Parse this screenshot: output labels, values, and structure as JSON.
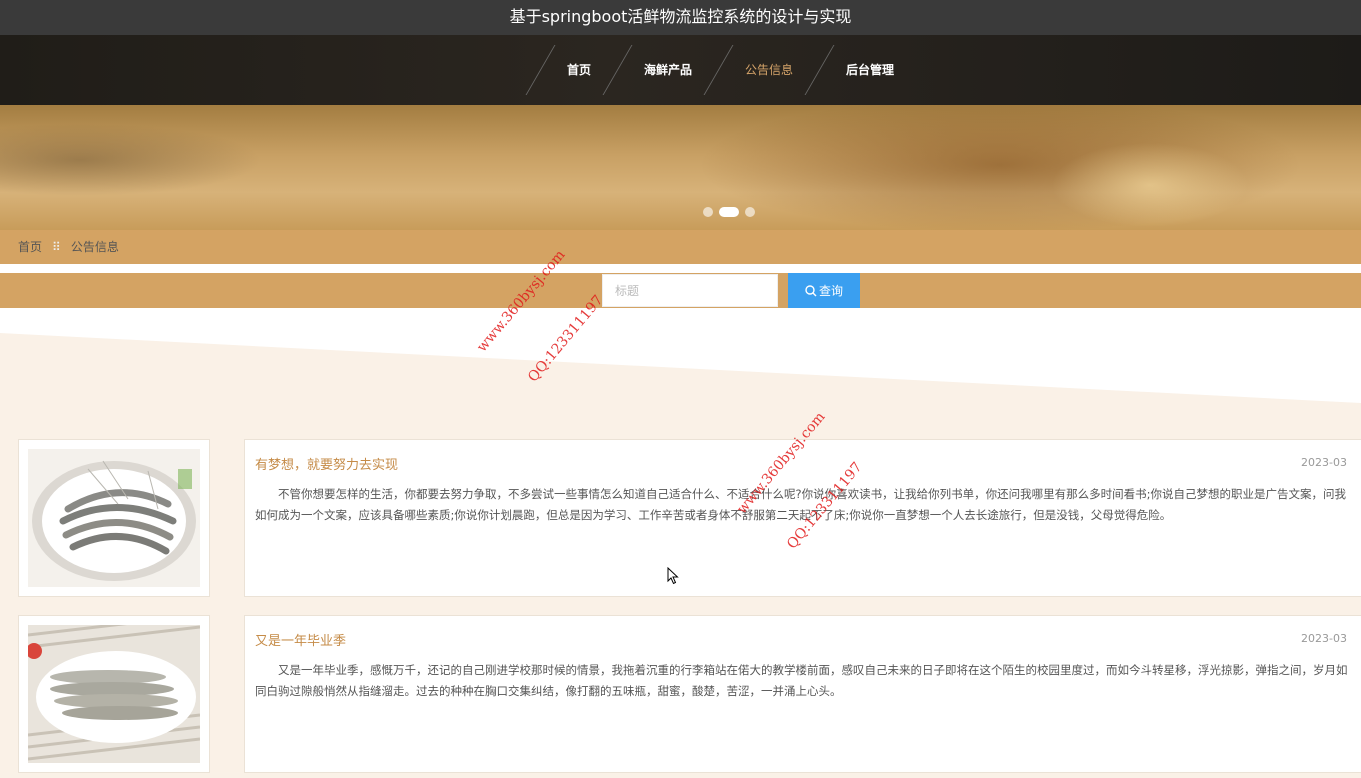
{
  "app": {
    "title": "基于springboot活鲜物流监控系统的设计与实现"
  },
  "nav": {
    "items": [
      "首页",
      "海鲜产品",
      "公告信息",
      "后台管理"
    ],
    "active": "公告信息"
  },
  "carousel": {
    "slides": 3,
    "active_index": 1
  },
  "breadcrumb": {
    "home": "首页",
    "separator": "⠿",
    "current": "公告信息"
  },
  "search": {
    "placeholder": "标题",
    "value": "",
    "button_label": "查询",
    "button_icon": "search-icon"
  },
  "notices": [
    {
      "title": "有梦想，就要努力去实现",
      "date": "2023-03",
      "body": "不管你想要怎样的生活，你都要去努力争取，不多尝试一些事情怎么知道自己适合什么、不适合什么呢?你说你喜欢读书，让我给你列书单，你还问我哪里有那么多时间看书;你说自己梦想的职业是广告文案，问我如何成为一个文案，应该具备哪些素质;你说你计划晨跑，但总是因为学习、工作辛苦或者身体不舒服第二天起不了床;你说你一直梦想一个人去长途旅行，但是没钱，父母觉得危险。",
      "image": "shrimp-on-plate"
    },
    {
      "title": "又是一年毕业季",
      "date": "2023-03",
      "body": "又是一年毕业季，感慨万千，还记的自己刚进学校那时候的情景，我拖着沉重的行李箱站在偌大的教学楼前面，感叹自己未来的日子即将在这个陌生的校园里度过，而如今斗转星移，浮光掠影，弹指之间，岁月如同白驹过隙般悄然从指缝溜走。过去的种种在胸口交集纠结，像打翻的五味瓶，甜蜜，酸楚，苦涩，一并涌上心头。",
      "image": "fish-on-plate"
    }
  ],
  "watermarks": [
    {
      "line1": "www.360bysj.com",
      "line2": "QQ:123311197"
    },
    {
      "line1": "www.360bysj.com",
      "line2": "QQ:123311197"
    }
  ],
  "colors": {
    "accent": "#d4a363",
    "title_text": "#c58b47",
    "search_button": "#3a9ff0",
    "titlebar": "#3a3a3a",
    "content_bg": "#faf1e7"
  }
}
